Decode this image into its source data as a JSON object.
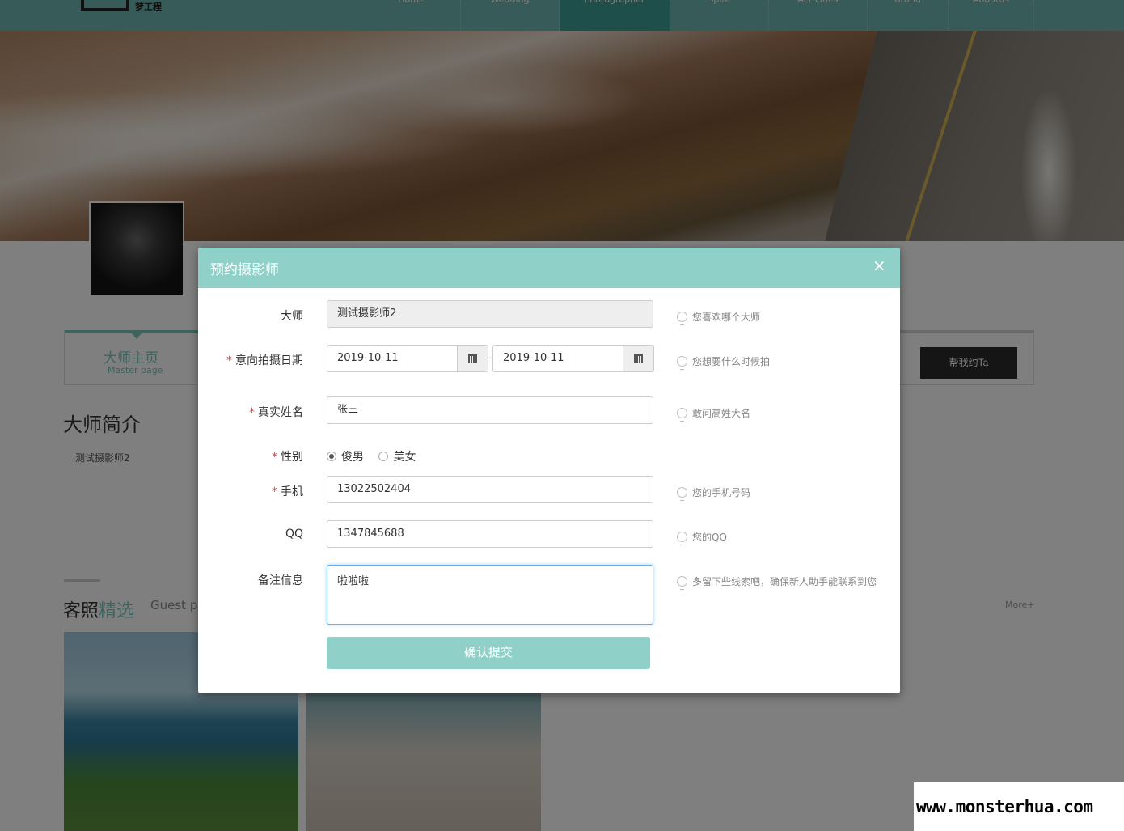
{
  "site": {
    "logo_text": "梦工程",
    "nav": [
      "Home",
      "Wedding",
      "Photographer",
      "Spire",
      "Activities",
      "Brand",
      "Aboutus"
    ],
    "nav_active_index": 2
  },
  "profile": {
    "tab_title": "大师主页",
    "tab_sub": "Master page",
    "book_button": "帮我约Ta",
    "intro_title": "大师简介",
    "intro_text": "测试摄影师2"
  },
  "section": {
    "title_part1": "客照",
    "title_part2": "精选",
    "sub": "Guest pl",
    "more": "More+"
  },
  "modal": {
    "title": "预约摄影师",
    "close_icon": "×",
    "fields": {
      "master": {
        "label": "大师",
        "value": "测试摄影师2",
        "hint": "您喜欢哪个大师"
      },
      "date": {
        "label": "意向拍摄日期",
        "start": "2019-10-11",
        "end": "2019-10-11",
        "separator": "-",
        "hint": "您想要什么时候拍"
      },
      "name": {
        "label": "真实姓名",
        "value": "张三",
        "hint": "敢问高姓大名"
      },
      "gender": {
        "label": "性别",
        "options": [
          "俊男",
          "美女"
        ],
        "selected": "俊男"
      },
      "phone": {
        "label": "手机",
        "value": "13022502404",
        "hint": "您的手机号码"
      },
      "qq": {
        "label": "QQ",
        "value": "1347845688",
        "hint": "您的QQ"
      },
      "note": {
        "label": "备注信息",
        "value": "啦啦啦",
        "hint": "多留下些线索吧，确保新人助手能联系到您"
      }
    },
    "required_mark": "*",
    "submit": "确认提交"
  },
  "watermark": "www.monsterhua.com",
  "colors": {
    "accent": "#8fd0c8",
    "nav_bg": "#6fb7b0",
    "nav_active": "#3d9e96",
    "required": "#e23b3b",
    "focus": "#66afe9"
  }
}
